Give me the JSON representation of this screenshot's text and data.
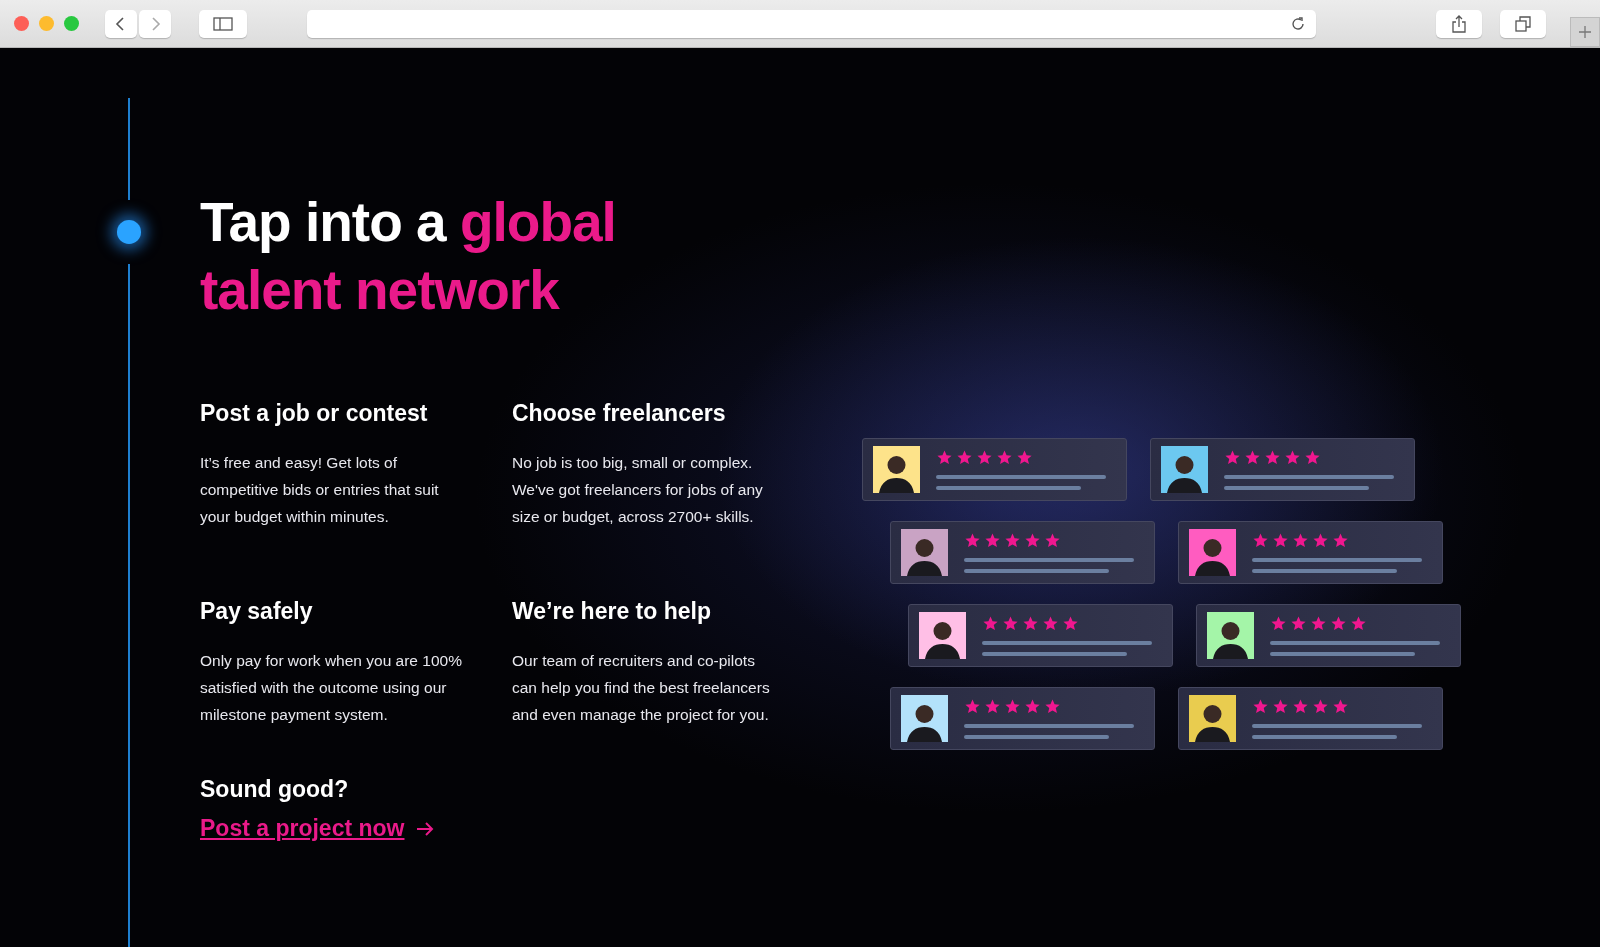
{
  "heading": {
    "lead": "Tap into a ",
    "highlight": "global talent network"
  },
  "features": [
    {
      "title": "Post a job or contest",
      "body": "It’s free and easy! Get lots of competitive bids or entries that suit your budget within minutes."
    },
    {
      "title": "Choose freelancers",
      "body": "No job is too big, small or complex. We've got freelancers for jobs of any size or budget, across 2700+ skills."
    },
    {
      "title": "Pay safely",
      "body": "Only pay for work when you are 100% satisfied with the outcome using our milestone payment system."
    },
    {
      "title": "We’re here to help",
      "body": "Our team of recruiters and co-pilots can help you find the best freelancers and even manage the project for you."
    }
  ],
  "cta": {
    "question": "Sound good?",
    "link": "Post a project now"
  },
  "cards": [
    {
      "stars": 5,
      "color": "#fde38a"
    },
    {
      "stars": 5,
      "color": "#6cc8f0"
    },
    {
      "stars": 5,
      "color": "#c9a3c4"
    },
    {
      "stars": 5,
      "color": "#ff5cc0"
    },
    {
      "stars": 5,
      "color": "#ffbfe6"
    },
    {
      "stars": 5,
      "color": "#a4f5a8"
    },
    {
      "stars": 5,
      "color": "#b3e2fb"
    },
    {
      "stars": 5,
      "color": "#e9cc4f"
    }
  ]
}
